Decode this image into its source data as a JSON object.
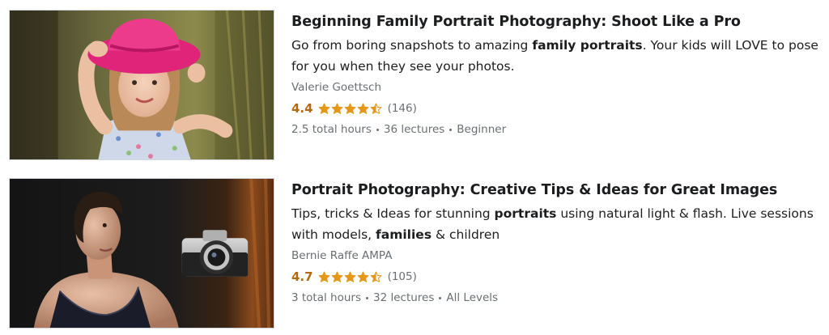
{
  "courses": [
    {
      "title": "Beginning Family Portrait Photography: Shoot Like a Pro",
      "headline": {
        "part1": "Go from boring snapshots to amazing ",
        "bold1": "family portraits",
        "part2": ". Your kids will LOVE to pose for you when they see your photos."
      },
      "instructor": "Valerie Goettsch",
      "rating": "4.4",
      "stars_filled": 4.4,
      "rating_count": "(146)",
      "duration": "2.5 total hours",
      "lectures": "36 lectures",
      "level": "Beginner"
    },
    {
      "title": "Portrait Photography: Creative Tips & Ideas for Great Images",
      "headline": {
        "part1": "Tips, tricks & Ideas for stunning ",
        "bold1": "portraits",
        "part2": " using natural light & flash. Live sessions with models, ",
        "bold2": "families",
        "part3": " & children"
      },
      "instructor": "Bernie Raffe AMPA",
      "rating": "4.7",
      "stars_filled": 4.7,
      "rating_count": "(105)",
      "duration": "3 total hours",
      "lectures": "32 lectures",
      "level": "All Levels"
    }
  ],
  "colors": {
    "rating": "#b4690e",
    "star": "#e59819",
    "muted_text": "#6a6f73",
    "title_text": "#1c1d1f"
  }
}
